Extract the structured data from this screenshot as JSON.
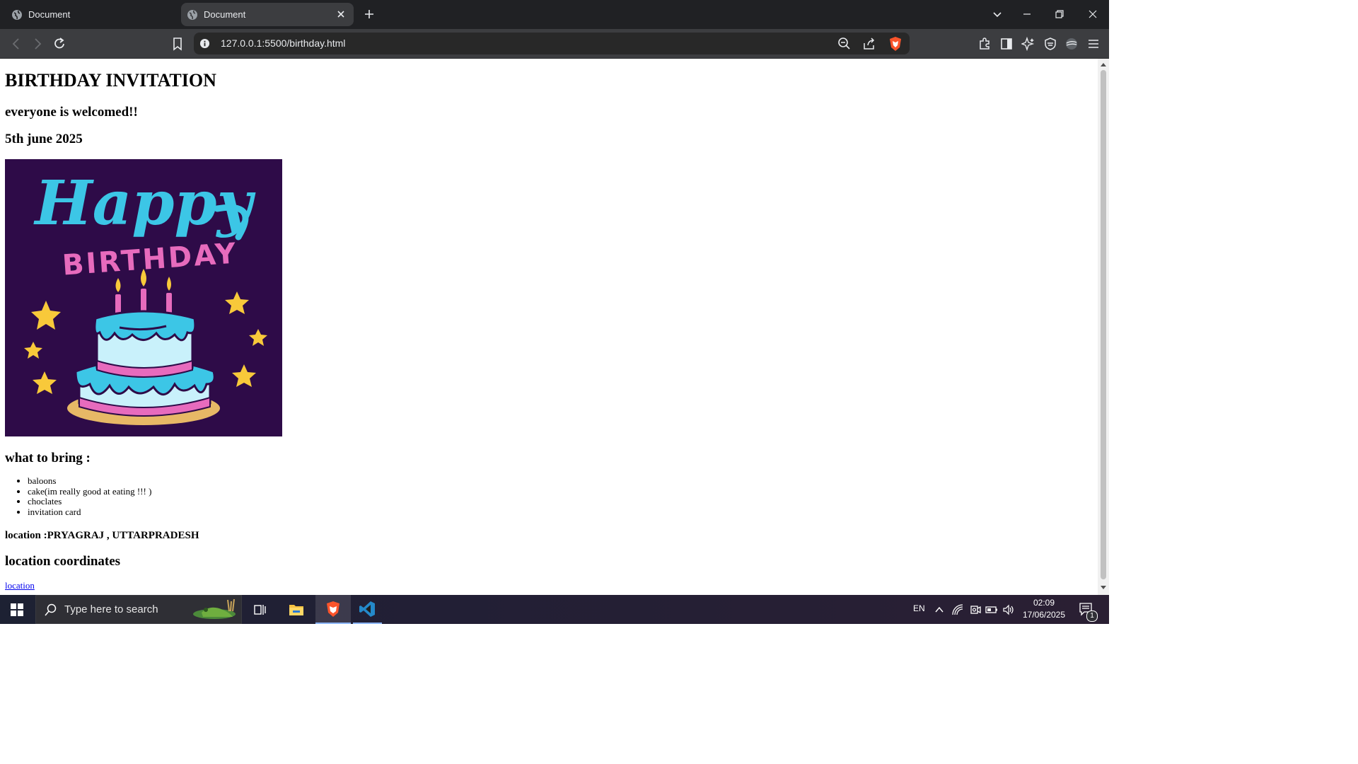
{
  "browser": {
    "tabs": [
      {
        "label": "Document",
        "active": false
      },
      {
        "label": "Document",
        "active": true
      }
    ],
    "url": "127.0.0.1:5500/birthday.html"
  },
  "page": {
    "title": "BIRTHDAY INVITATION",
    "welcome": "everyone is welcomed!!",
    "date": "5th june 2025",
    "image": {
      "line1": "Happy",
      "line2": "BIRTHDAY"
    },
    "bring_heading": "what to bring :",
    "bring_items": [
      "baloons",
      "cake(im really good at eating !!! )",
      "choclates",
      "invitation card"
    ],
    "location": "location :PRYAGRAJ , UTTARPRADESH",
    "coords_heading": "location coordinates",
    "link_text": "location"
  },
  "taskbar": {
    "search_placeholder": "Type here to search",
    "lang": "EN",
    "time": "02:09",
    "date": "17/06/2025",
    "notification_count": "1"
  },
  "colors": {
    "card_bg": "#2e0b48",
    "cyan": "#3cc6e6",
    "pink": "#e76bbd",
    "yellow": "#f8c93a"
  }
}
